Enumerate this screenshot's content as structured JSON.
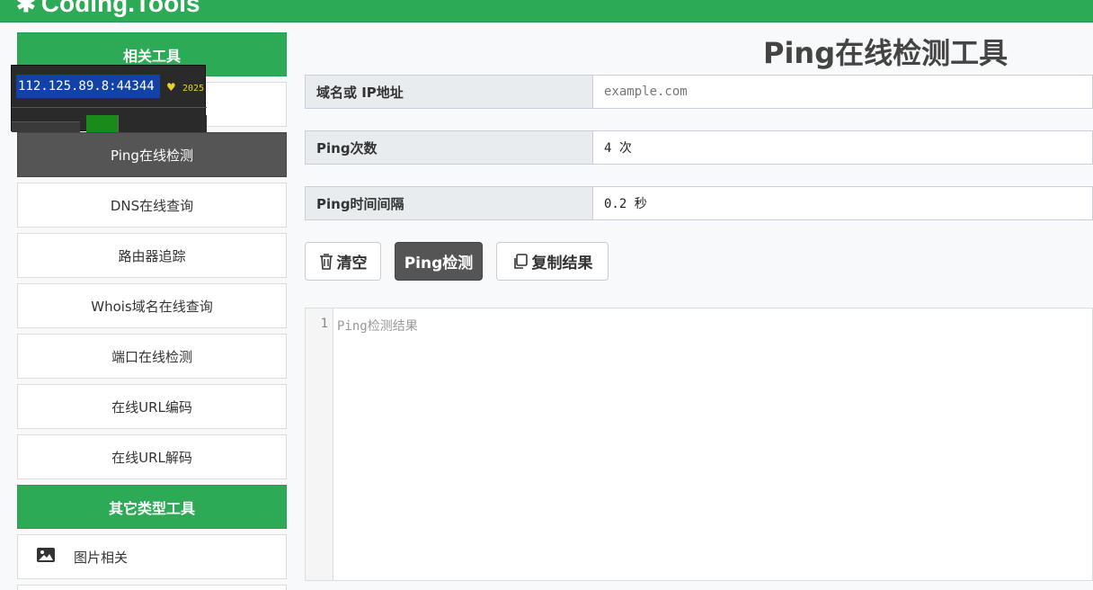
{
  "brand": {
    "name": "Coding.Tools",
    "logo_icon": "logo-icon"
  },
  "sidebar": {
    "header": "相关工具",
    "items": [
      {
        "label": "Ping在线检测",
        "active": true
      },
      {
        "label": "DNS在线查询"
      },
      {
        "label": "路由器追踪"
      },
      {
        "label": "Whois域名在线查询"
      },
      {
        "label": "端口在线检测"
      },
      {
        "label": "在线URL编码"
      },
      {
        "label": "在线URL解码"
      }
    ],
    "header2": "其它类型工具",
    "other_items": [
      {
        "label": "图片相关",
        "icon": "image-icon"
      }
    ]
  },
  "overlay": {
    "ip": "112.125.89.8:44344",
    "year": "2025"
  },
  "main": {
    "title": "Ping在线检测工具",
    "fields": [
      {
        "label": "域名或 IP地址",
        "placeholder": "example.com",
        "value": ""
      },
      {
        "label": "Ping次数",
        "placeholder": "",
        "value": "4 次"
      },
      {
        "label": "Ping时间间隔",
        "placeholder": "",
        "value": "0.2 秒"
      }
    ],
    "buttons": {
      "clear": "清空",
      "ping": "Ping检测",
      "copy": "复制结果"
    },
    "editor": {
      "line_number": "1",
      "placeholder": "Ping检测结果"
    }
  },
  "colors": {
    "accent": "#2daa55",
    "dark_button": "#555555"
  }
}
